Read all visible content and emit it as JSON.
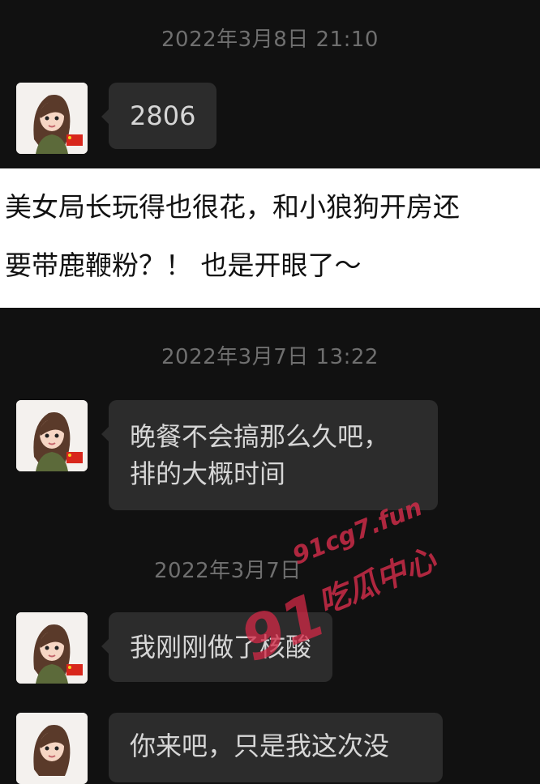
{
  "chat": {
    "messages": [
      {
        "timestamp": "2022年3月8日 21:10",
        "text": "2806"
      },
      {
        "timestamp": "2022年3月7日 13:22",
        "text": "晚餐不会搞那么久吧，\n排的大概时间"
      },
      {
        "timestamp": "2022年3月7日",
        "text": "我刚刚做了核酸"
      },
      {
        "text": "你来吧，只是我这次没"
      }
    ],
    "avatar_icon": "woman-cartoon-avatar-with-china-flag"
  },
  "caption": {
    "line1": "美女局长玩得也很花，和小狼狗开房还",
    "line2": "要带鹿鞭粉？！ 也是开眼了～"
  },
  "watermark": {
    "number": "91",
    "domain": "91cg7.fun",
    "label": "吃瓜中心",
    "color": "#d22846"
  }
}
